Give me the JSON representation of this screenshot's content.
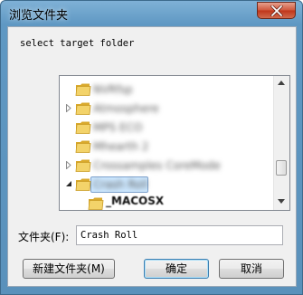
{
  "window": {
    "title": "浏览文件夹"
  },
  "dialog": {
    "instruction": "select target folder",
    "folder_label": "文件夹(F):",
    "folder_value": "Crash Roll"
  },
  "tree": {
    "items": [
      {
        "label": "NVRfsp",
        "expandable": false,
        "selected": false
      },
      {
        "label": "Atmosphere",
        "expandable": true,
        "selected": false
      },
      {
        "label": "MPS ECO",
        "expandable": false,
        "selected": false
      },
      {
        "label": "Mhearth 2",
        "expandable": false,
        "selected": false
      },
      {
        "label": "Crossamples CoreMode",
        "expandable": true,
        "selected": false
      },
      {
        "label": "Crash Roll",
        "expandable": true,
        "expanded": true,
        "selected": true
      },
      {
        "label": "_MACOSX",
        "expandable": false,
        "selected": false,
        "child": true
      }
    ]
  },
  "buttons": {
    "new_folder": "新建文件夹(M)",
    "ok": "确定",
    "cancel": "取消"
  },
  "icons": {
    "close": "close-icon",
    "folder": "folder-icon",
    "expand": "expand-arrow-icon",
    "collapse": "collapse-arrow-icon",
    "scroll_up": "scroll-up-icon",
    "scroll_down": "scroll-down-icon"
  },
  "colors": {
    "titlebar": "#6aa0c8",
    "selection": "#cde8ff",
    "folder_yellow": "#e8c043",
    "close_red": "#c9462a"
  }
}
